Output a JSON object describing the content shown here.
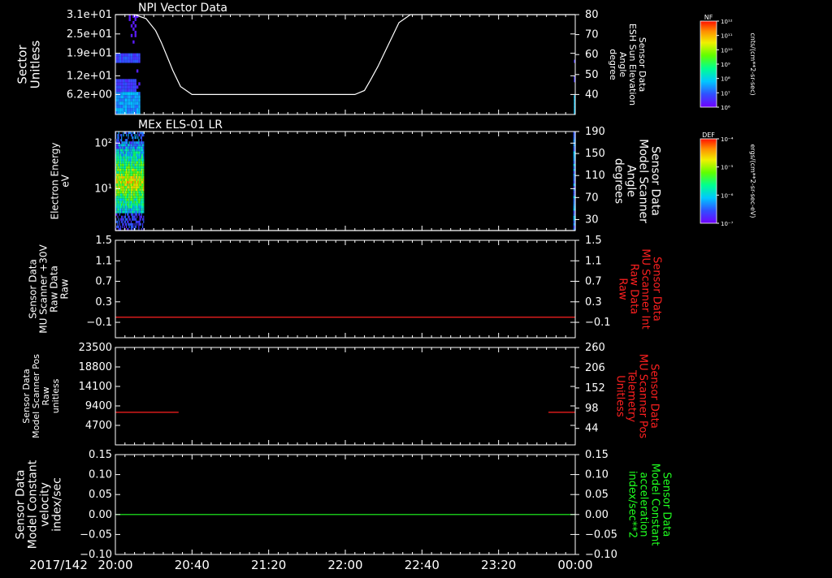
{
  "time_axis": {
    "date_label": "2017/142",
    "start": "20:00",
    "end": "00:00",
    "range_minutes": [
      0,
      240
    ],
    "major_ticks": [
      {
        "minutes": 0,
        "label": "20:00"
      },
      {
        "minutes": 40,
        "label": "20:40"
      },
      {
        "minutes": 80,
        "label": "21:20"
      },
      {
        "minutes": 120,
        "label": "22:00"
      },
      {
        "minutes": 160,
        "label": "22:40"
      },
      {
        "minutes": 200,
        "label": "23:20"
      },
      {
        "minutes": 240,
        "label": "00:00"
      }
    ],
    "minor_tick_minutes": 5
  },
  "colorbars": [
    {
      "label": "NF",
      "unit": "cnts/(cm**2-sr-sec)",
      "tick_labels": [
        "10¹²",
        "10¹¹",
        "10¹⁰",
        "10⁹",
        "10⁸",
        "10⁷",
        "10⁶"
      ]
    },
    {
      "label": "DEF",
      "unit": "ergs/(cm**2-sr-sec-eV)",
      "tick_labels": [
        "10⁻⁴",
        "10⁻⁵",
        "10⁻⁶",
        "10⁻⁷"
      ]
    }
  ],
  "chart_data": [
    {
      "type": "heatmap",
      "title": "NPI Vector Data",
      "ylabel": [
        "Sector",
        "Unitless"
      ],
      "y_tick_labels": [
        "3.1e+01",
        "2.5e+01",
        "1.9e+01",
        "1.2e+01",
        "6.2e+00"
      ],
      "y_ticks": [
        31,
        25,
        19,
        12,
        6.2
      ],
      "ylim": [
        0,
        31
      ],
      "right_axis": {
        "label": [
          "Sensor Data",
          "ESH Sun Elevation",
          "Angle",
          "degree"
        ],
        "ticks": [
          80,
          70,
          60,
          50,
          40
        ],
        "ylim": [
          30,
          80
        ]
      },
      "series": [
        {
          "name": "Sensor Data ESH Sun Elevation Angle",
          "color": "#ffffff",
          "x_minutes": [
            0,
            10,
            16,
            21,
            24,
            27,
            30,
            34,
            40,
            60,
            100,
            125,
            130,
            133,
            137,
            141,
            145,
            148,
            154,
            160,
            200,
            240
          ],
          "values": [
            80,
            80,
            78,
            72,
            66,
            59,
            52,
            44,
            40,
            40,
            40,
            40,
            42,
            47,
            54,
            62,
            70,
            76,
            80,
            80,
            80,
            80
          ]
        }
      ]
    },
    {
      "type": "heatmap",
      "title": "MEx ELS-01 LR",
      "ylabel": [
        "Electron Energy",
        "eV"
      ],
      "y_tick_labels": [
        "10²",
        "10¹"
      ],
      "y_ticks": [
        100,
        10
      ],
      "yscale": "log",
      "ylim": [
        1.2,
        180
      ],
      "right_axis": {
        "label": [
          "Sensor Data",
          "Model Scanner",
          "Angle",
          "degrees"
        ],
        "ticks": [
          190,
          150,
          110,
          70,
          30
        ],
        "ylim": [
          10,
          190
        ]
      },
      "series": [
        {
          "name": "Sensor Data Model Scanner Angle",
          "color": "#ffffff",
          "x_minutes": [
            0,
            240
          ],
          "values": [
            10,
            10
          ]
        }
      ]
    },
    {
      "type": "line",
      "title": "",
      "ylabel": [
        "Sensor Data",
        "MU Scanner +30V",
        "Raw Data",
        "Raw"
      ],
      "y_ticks": [
        1.5,
        1.1,
        0.7,
        0.3,
        -0.1
      ],
      "y_tick_labels": [
        "1.5",
        "1.1",
        "0.7",
        "0.3",
        "−0.1"
      ],
      "ylim": [
        -0.4,
        1.5
      ],
      "right_axis": {
        "label": [
          "Sensor Data",
          "MU Scanner Int",
          "Raw Data",
          "Raw"
        ],
        "label_color": "#ff2020",
        "ticks": [
          1.5,
          1.1,
          0.7,
          0.3,
          -0.1
        ],
        "tick_labels": [
          "1.5",
          "1.1",
          "0.7",
          "0.3",
          "−0.1"
        ],
        "ylim": [
          -0.4,
          1.5
        ]
      },
      "series": [
        {
          "name": "Sensor Data MU Scanner Int Raw Data",
          "color": "#ff2020",
          "x_minutes": [
            0,
            240
          ],
          "values": [
            0,
            0
          ]
        }
      ]
    },
    {
      "type": "line",
      "title": "",
      "ylabel": [
        "Sensor Data",
        "Model Scanner Pos",
        "Raw",
        "unitless"
      ],
      "y_ticks": [
        23500,
        18800,
        14100,
        9400,
        4700
      ],
      "y_tick_labels": [
        "23500",
        "18800",
        "14100",
        "9400",
        "4700"
      ],
      "ylim": [
        0,
        23500
      ],
      "right_axis": {
        "label": [
          "Sensor Data",
          "MU Scanner Pos",
          "Telemetry",
          "Unitless"
        ],
        "label_color": "#ff2020",
        "ticks": [
          260,
          206,
          152,
          98,
          44
        ],
        "ylim": [
          0,
          260
        ]
      },
      "series": [
        {
          "name": "Sensor Data MU Scanner Pos Telemetry",
          "color": "#ff2020",
          "axis": "right",
          "segments": [
            {
              "x_minutes": [
                0,
                33
              ],
              "values": [
                87,
                87
              ]
            },
            {
              "x_minutes": [
                226,
                240
              ],
              "values": [
                87,
                87
              ]
            }
          ]
        }
      ]
    },
    {
      "type": "line",
      "title": "",
      "ylabel": [
        "Sensor Data",
        "Model Constant",
        "velocity",
        "index/sec"
      ],
      "y_ticks": [
        0.15,
        0.1,
        0.05,
        0.0,
        -0.05,
        -0.1
      ],
      "y_tick_labels": [
        "0.15",
        "0.10",
        "0.05",
        "0.00",
        "−0.05",
        "−0.10"
      ],
      "ylim": [
        -0.1,
        0.15
      ],
      "right_axis": {
        "label": [
          "Sensor Data",
          "Model Constant",
          "acceleration",
          "index/sec**2"
        ],
        "label_color": "#20ff20",
        "ticks": [
          0.15,
          0.1,
          0.05,
          0.0,
          -0.05,
          -0.1
        ],
        "tick_labels": [
          "0.15",
          "0.10",
          "0.05",
          "0.00",
          "−0.05",
          "−0.10"
        ],
        "ylim": [
          -0.1,
          0.15
        ]
      },
      "series": [
        {
          "name": "Sensor Data Model Constant acceleration",
          "color": "#20ff20",
          "x_minutes": [
            0,
            240
          ],
          "values": [
            0,
            0
          ]
        }
      ]
    }
  ]
}
